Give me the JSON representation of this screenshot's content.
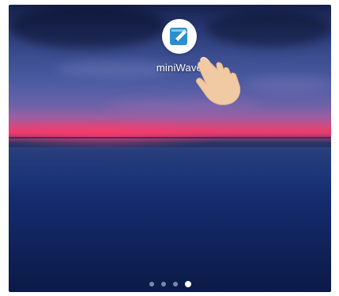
{
  "home_screen": {
    "app": {
      "label": "miniWave",
      "icon": "pencil-note-icon",
      "icon_color": "#2b8fd0"
    },
    "pager": {
      "pages": 4,
      "current_page": 4
    },
    "pointer": "tap-hand-icon"
  }
}
